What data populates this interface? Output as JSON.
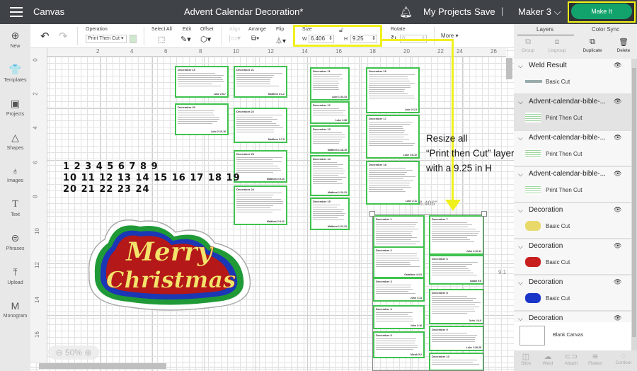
{
  "topbar": {
    "menu_icon": "hamburger-icon",
    "section": "Canvas",
    "title": "Advent Calendar Decoration*",
    "notification_icon": "bell-icon",
    "my_projects": "My Projects",
    "save": "Save",
    "separator": "|",
    "machine": "Maker 3",
    "machine_chevron": "⌵",
    "make_it": "Make It",
    "colors": {
      "bar": "#3f4247",
      "make_it": "#12a26b",
      "highlight": "#f0f01e"
    }
  },
  "toolbar": {
    "undo_icon": "↶",
    "redo_icon": "↷",
    "operation_label": "Operation",
    "operation_value": "Print Then Cut ▾",
    "select_all": "Select All",
    "edit": "Edit",
    "offset": "Offset",
    "align": "Align",
    "arrange": "Arrange",
    "flip": "Flip",
    "size_label": "Size",
    "w_label": "W",
    "w_value": "6.406",
    "h_label": "H",
    "h_value": "9.25",
    "lock_icon": "🔒",
    "rotate_label": "Rotate",
    "rotate_value": "0",
    "more": "More ▾"
  },
  "left_nav": [
    {
      "label": "New",
      "icon": "⊕"
    },
    {
      "label": "Templates",
      "icon": "👕"
    },
    {
      "label": "Projects",
      "icon": "▣"
    },
    {
      "label": "Shapes",
      "icon": "△"
    },
    {
      "label": "Images",
      "icon": "♁"
    },
    {
      "label": "Text",
      "icon": "T"
    },
    {
      "label": "Phrases",
      "icon": "⊜"
    },
    {
      "label": "Upload",
      "icon": "⤒"
    },
    {
      "label": "Monogram",
      "icon": "M"
    }
  ],
  "rulers": {
    "top": [
      "2",
      "4",
      "6",
      "8",
      "10",
      "12",
      "14",
      "16",
      "18",
      "20",
      "22",
      "24",
      "26"
    ],
    "left": [
      "0",
      "2",
      "4",
      "6",
      "8",
      "10",
      "12",
      "14",
      "16"
    ]
  },
  "canvas": {
    "numbers_lines": [
      "1 2 3 4 5 6 7 8 9",
      "10 11 12 13 14 15 16 17 18 19",
      "20 21 22 23 24"
    ],
    "decoration_text": [
      "Merry",
      "Christmas"
    ],
    "annotation": [
      "Resize all",
      "“Print then Cut” layers",
      "with a 9.25 in H"
    ],
    "width_label": "6.406\"",
    "side_label": "9.1",
    "zoom_minus": "⊖",
    "zoom_level": "50%",
    "zoom_plus": "⊕",
    "cards": [
      {
        "title": "December 19",
        "ref": "Luke 2:6-7"
      },
      {
        "title": "December 20",
        "ref": "Luke 2:15-16"
      },
      {
        "title": "December 21",
        "ref": "Matthew 2:1-2"
      },
      {
        "title": "December 22",
        "ref": "Matthew 2:7-8"
      },
      {
        "title": "December 23",
        "ref": "Matthew 2:9-10"
      },
      {
        "title": "December 24",
        "ref": "Matthew 2:9-10"
      },
      {
        "title": "December 11",
        "ref": "Luke 1:30-33"
      },
      {
        "title": "December 12",
        "ref": "Luke 1:38"
      },
      {
        "title": "December 13",
        "ref": "Matthew 1:18-19"
      },
      {
        "title": "December 14",
        "ref": "Matthew 1:20-23"
      },
      {
        "title": "December 15",
        "ref": "Matthew 1:22-23"
      },
      {
        "title": "December 16",
        "ref": "Luke 2:1-5"
      },
      {
        "title": "December 17",
        "ref": "Luke 2:8-10"
      },
      {
        "title": "December 18",
        "ref": "Luke 2:11"
      },
      {
        "title": "December 1",
        "ref": "John 1:1-3"
      },
      {
        "title": "December 2",
        "ref": "Galatians 4:4-5"
      },
      {
        "title": "December 3",
        "ref": "John 1:14"
      },
      {
        "title": "December 4",
        "ref": "John 3:16"
      },
      {
        "title": "December 5",
        "ref": "Micah 5:2"
      },
      {
        "title": "December 7",
        "ref": "John 1:10-11"
      },
      {
        "title": "December 6",
        "ref": "Isaiah 9:6"
      },
      {
        "title": "December 8",
        "ref": "John 1:6-9"
      },
      {
        "title": "December 9",
        "ref": "Luke 1:26-28"
      },
      {
        "title": "December 10",
        "ref": ""
      }
    ]
  },
  "right_panel": {
    "tabs": [
      "Layers",
      "Color Sync"
    ],
    "tools": [
      {
        "label": "Group",
        "icon": "⧉",
        "enabled": false
      },
      {
        "label": "Ungroup",
        "icon": "⧈",
        "enabled": false
      },
      {
        "label": "Duplicate",
        "icon": "⧉",
        "enabled": true
      },
      {
        "label": "Delete",
        "icon": "🗑",
        "enabled": true
      }
    ],
    "layers": [
      {
        "name": "Weld Result",
        "sub": "Basic Cut",
        "thumb": "weld"
      },
      {
        "name": "Advent-calendar-bible-...",
        "sub": "Print Then Cut",
        "thumb": "cards"
      },
      {
        "name": "Advent-calendar-bible-...",
        "sub": "Print Then Cut",
        "thumb": "cards"
      },
      {
        "name": "Advent-calendar-bible-...",
        "sub": "Print Then Cut",
        "thumb": "cards"
      },
      {
        "name": "Decoration",
        "sub": "Basic Cut",
        "thumb": "yellow"
      },
      {
        "name": "Decoration",
        "sub": "Basic Cut",
        "thumb": "red"
      },
      {
        "name": "Decoration",
        "sub": "Basic Cut",
        "thumb": "blue"
      },
      {
        "name": "Decoration",
        "sub": "",
        "thumb": ""
      }
    ],
    "blank_canvas": "Blank Canvas",
    "bottom_tools": [
      {
        "label": "Slice",
        "icon": "◫"
      },
      {
        "label": "Weld",
        "icon": "☁"
      },
      {
        "label": "Attach",
        "icon": "⊂⊃"
      },
      {
        "label": "Flatten",
        "icon": "≋"
      },
      {
        "label": "Contour",
        "icon": "◌"
      }
    ],
    "thumb_colors": {
      "yellow": "#e8d96a",
      "red": "#c81e1e",
      "blue": "#1a35c8",
      "cards": "#9fd6a0",
      "weld": "#9aa"
    }
  }
}
